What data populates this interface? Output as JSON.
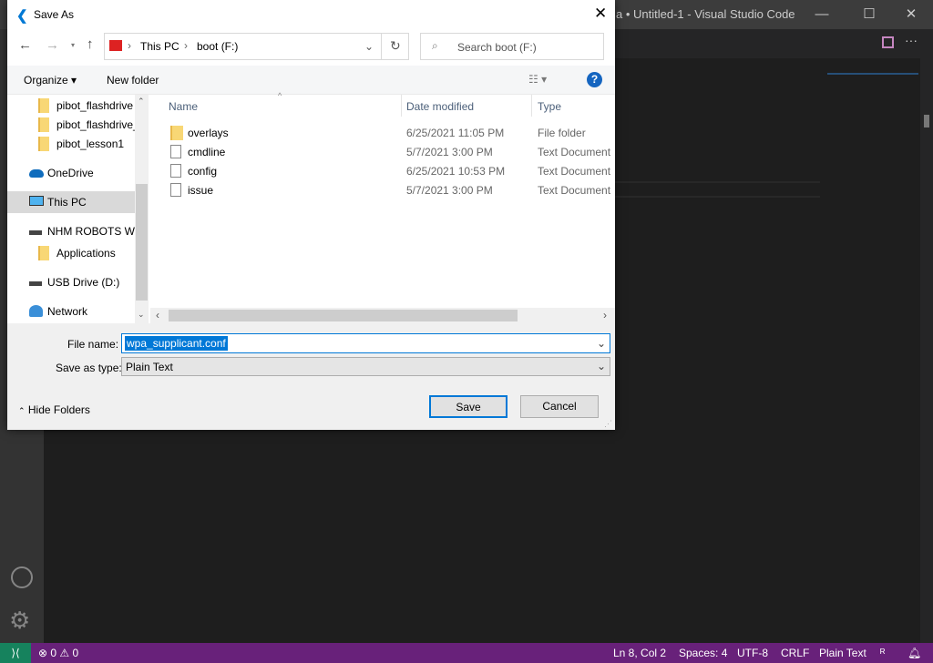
{
  "vscode": {
    "title": "a • Untitled-1 - Visual Studio Code",
    "status": {
      "problems_errors": "0",
      "problems_warnings": "0",
      "position": "Ln 8, Col 2",
      "spaces": "Spaces: 4",
      "encoding": "UTF-8",
      "eol": "CRLF",
      "language": "Plain Text"
    },
    "accent": "#68217a"
  },
  "dialog": {
    "title": "Save As",
    "address": [
      "This PC",
      "boot (F:)"
    ],
    "search_placeholder": "Search boot (F:)",
    "toolbar": {
      "organize": "Organize",
      "new_folder": "New folder"
    },
    "nav": [
      {
        "label": "pibot_flashdrive",
        "icon": "folder-icon"
      },
      {
        "label": "pibot_flashdrive_",
        "icon": "folder-icon"
      },
      {
        "label": "pibot_lesson1",
        "icon": "folder-icon"
      },
      {
        "label": "OneDrive",
        "icon": "cloud-icon"
      },
      {
        "label": "This PC",
        "icon": "computer-icon",
        "selected": true
      },
      {
        "label": "NHM ROBOTS WI",
        "icon": "drive-icon"
      },
      {
        "label": "Applications",
        "icon": "folder-icon"
      },
      {
        "label": "USB Drive (D:)",
        "icon": "drive-icon"
      },
      {
        "label": "Network",
        "icon": "network-icon"
      }
    ],
    "columns": [
      "Name",
      "Date modified",
      "Type"
    ],
    "files": [
      {
        "name": "overlays",
        "date": "6/25/2021 11:05 PM",
        "type": "File folder",
        "icon": "folder-icon"
      },
      {
        "name": "cmdline",
        "date": "5/7/2021 3:00 PM",
        "type": "Text Document",
        "icon": "document-icon"
      },
      {
        "name": "config",
        "date": "6/25/2021 10:53 PM",
        "type": "Text Document",
        "icon": "document-icon"
      },
      {
        "name": "issue",
        "date": "5/7/2021 3:00 PM",
        "type": "Text Document",
        "icon": "document-icon"
      }
    ],
    "file_name_label": "File name:",
    "file_name": "wpa_supplicant.conf",
    "save_type_label": "Save as type:",
    "save_type": "Plain Text",
    "hide_folders": "Hide Folders",
    "save": "Save",
    "cancel": "Cancel"
  }
}
